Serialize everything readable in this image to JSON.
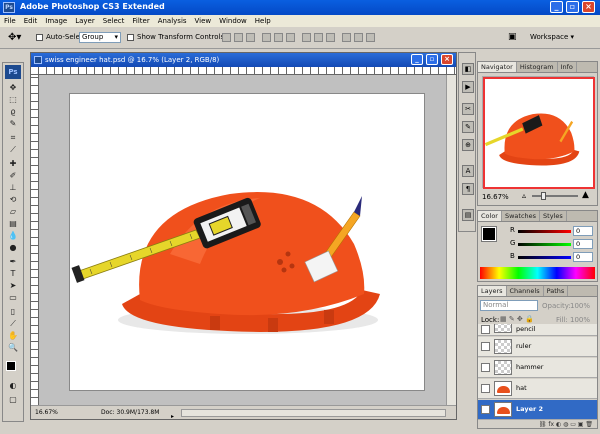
{
  "app": {
    "title": "Adobe Photoshop CS3 Extended",
    "logo": "Ps",
    "logo_mini": "Ps"
  },
  "menu": [
    "File",
    "Edit",
    "Image",
    "Layer",
    "Select",
    "Filter",
    "Analysis",
    "View",
    "Window",
    "Help"
  ],
  "options": {
    "auto_select_label": "Auto-Select:",
    "auto_select_value": "Group",
    "show_transform_label": "Show Transform Controls",
    "workspace_label": "Workspace"
  },
  "document": {
    "title": "swiss engineer hat.psd @ 16.7% (Layer 2, RGB/8)",
    "zoom": "16.67%",
    "doc_info": "Doc: 30.9M/173.8M"
  },
  "navigator": {
    "tabs": [
      "Navigator",
      "Histogram",
      "Info"
    ],
    "zoom": "16.67%"
  },
  "color": {
    "tabs": [
      "Color",
      "Swatches",
      "Styles"
    ],
    "channels": [
      {
        "label": "R",
        "value": "0"
      },
      {
        "label": "G",
        "value": "0"
      },
      {
        "label": "B",
        "value": "0"
      }
    ]
  },
  "layers": {
    "tabs": [
      "Layers",
      "Channels",
      "Paths"
    ],
    "blend_mode": "Normal",
    "opacity_label": "Opacity:",
    "opacity_value": "100%",
    "lock_label": "Lock:",
    "fill_label": "Fill:",
    "fill_value": "100%",
    "items": [
      {
        "name": "pencil"
      },
      {
        "name": "ruler"
      },
      {
        "name": "hammer"
      },
      {
        "name": "hat"
      },
      {
        "name": "Layer 2",
        "selected": true
      }
    ]
  }
}
